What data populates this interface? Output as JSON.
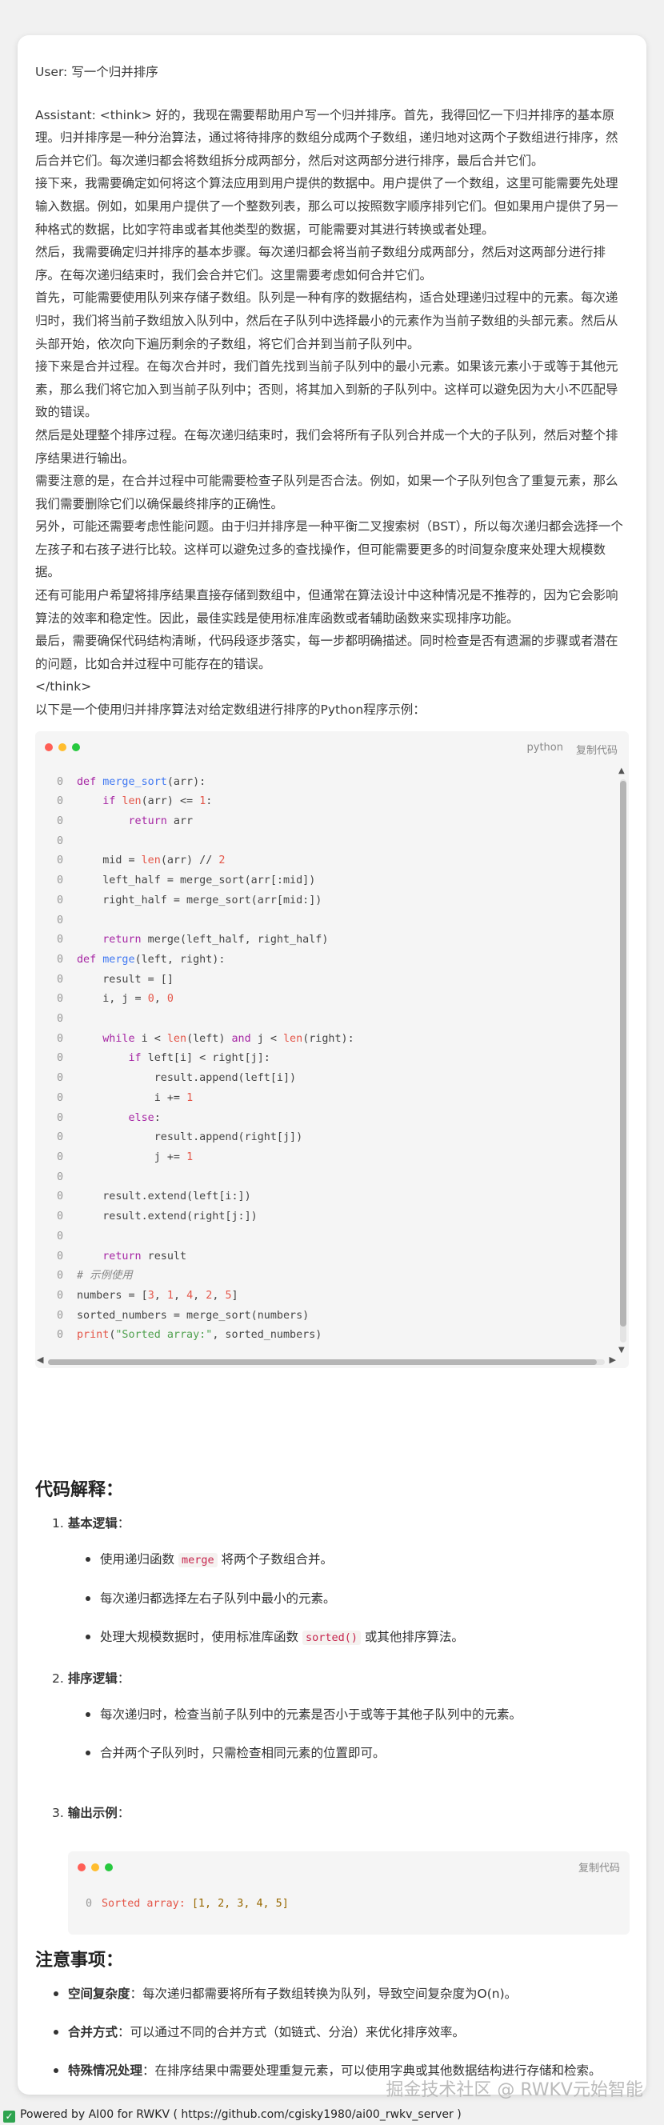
{
  "conversation": {
    "user_line": "User: 写一个归并排序",
    "assistant_paragraphs": [
      "Assistant: <think> 好的，我现在需要帮助用户写一个归并排序。首先，我得回忆一下归并排序的基本原理。归并排序是一种分治算法，通过将待排序的数组分成两个子数组，递归地对这两个子数组进行排序，然后合并它们。每次递归都会将数组拆分成两部分，然后对这两部分进行排序，最后合并它们。",
      "接下来，我需要确定如何将这个算法应用到用户提供的数据中。用户提供了一个数组，这里可能需要先处理输入数据。例如，如果用户提供了一个整数列表，那么可以按照数字顺序排列它们。但如果用户提供了另一种格式的数据，比如字符串或者其他类型的数据，可能需要对其进行转换或者处理。",
      "然后，我需要确定归并排序的基本步骤。每次递归都会将当前子数组分成两部分，然后对这两部分进行排序。在每次递归结束时，我们会合并它们。这里需要考虑如何合并它们。",
      "首先，可能需要使用队列来存储子数组。队列是一种有序的数据结构，适合处理递归过程中的元素。每次递归时，我们将当前子数组放入队列中，然后在子队列中选择最小的元素作为当前子数组的头部元素。然后从头部开始，依次向下遍历剩余的子数组，将它们合并到当前子队列中。",
      "接下来是合并过程。在每次合并时，我们首先找到当前子队列中的最小元素。如果该元素小于或等于其他元素，那么我们将它加入到当前子队列中；否则，将其加入到新的子队列中。这样可以避免因为大小不匹配导致的错误。",
      "然后是处理整个排序过程。在每次递归结束时，我们会将所有子队列合并成一个大的子队列，然后对整个排序结果进行输出。",
      "需要注意的是，在合并过程中可能需要检查子队列是否合法。例如，如果一个子队列包含了重复元素，那么我们需要删除它们以确保最终排序的正确性。",
      "另外，可能还需要考虑性能问题。由于归并排序是一种平衡二叉搜索树（BST），所以每次递归都会选择一个左孩子和右孩子进行比较。这样可以避免过多的查找操作，但可能需要更多的时间复杂度来处理大规模数据。",
      "还有可能用户希望将排序结果直接存储到数组中，但通常在算法设计中这种情况是不推荐的，因为它会影响算法的效率和稳定性。因此，最佳实践是使用标准库函数或者辅助函数来实现排序功能。",
      "最后，需要确保代码结构清晰，代码段逐步落实，每一步都明确描述。同时检查是否有遗漏的步骤或者潜在的问题，比如合并过程中可能存在的错误。",
      "</think>",
      "以下是一个使用归并排序算法对给定数组进行排序的Python程序示例："
    ]
  },
  "codeblock": {
    "language": "python",
    "copy_label": "复制代码",
    "line_number": "0",
    "lines": [
      "def merge_sort(arr):",
      "    if len(arr) <= 1:",
      "        return arr",
      "",
      "    mid = len(arr) // 2",
      "    left_half = merge_sort(arr[:mid])",
      "    right_half = merge_sort(arr[mid:])",
      "",
      "    return merge(left_half, right_half)",
      "def merge(left, right):",
      "    result = []",
      "    i, j = 0, 0",
      "",
      "    while i < len(left) and j < len(right):",
      "        if left[i] < right[j]:",
      "            result.append(left[i])",
      "            i += 1",
      "        else:",
      "            result.append(right[j])",
      "            j += 1",
      "",
      "    result.extend(left[i:])",
      "    result.extend(right[j:])",
      "",
      "    return result",
      "# 示例使用",
      "numbers = [3, 1, 4, 2, 5]",
      "sorted_numbers = merge_sort(numbers)",
      "print(\"Sorted array:\", sorted_numbers)"
    ]
  },
  "explanation": {
    "heading": "代码解释：",
    "items": [
      {
        "number": "1.",
        "title": "基本逻辑",
        "colon": "：",
        "bullets": [
          {
            "pre": "使用递归函数 ",
            "code": "merge",
            "post": " 将两个子数组合并。"
          },
          {
            "pre": "每次递归都选择左右子队列中最小的元素。",
            "code": "",
            "post": ""
          },
          {
            "pre": "处理大规模数据时，使用标准库函数 ",
            "code": "sorted()",
            "post": " 或其他排序算法。"
          }
        ]
      },
      {
        "number": "2.",
        "title": "排序逻辑",
        "colon": "：",
        "bullets": [
          {
            "pre": "每次递归时，检查当前子队列中的元素是否小于或等于其他子队列中的元素。",
            "code": "",
            "post": ""
          },
          {
            "pre": "合并两个子队列时，只需检查相同元素的位置即可。",
            "code": "",
            "post": ""
          }
        ]
      },
      {
        "number": "3.",
        "title": "输出示例",
        "colon": "：",
        "bullets": []
      }
    ],
    "output_code": {
      "copy_label": "复制代码",
      "line_number": "0",
      "text_plain": "Sorted array: ",
      "text_value": "[1, 2, 3, 4, 5]"
    }
  },
  "notes": {
    "heading": "注意事项：",
    "items": [
      {
        "title": "空间复杂度",
        "text": "：每次递归都需要将所有子数组转换为队列，导致空间复杂度为O(n)。"
      },
      {
        "title": "合并方式",
        "text": "：可以通过不同的合并方式（如链式、分治）来优化排序效率。"
      },
      {
        "title": "特殊情况处理",
        "text": "：在排序结果中需要处理重复元素，可以使用字典或其他数据结构进行存储和检索。"
      }
    ]
  },
  "watermark": "掘金技术社区 @ RWKV元始智能",
  "footer": {
    "text": "Powered by AI00 for RWKV ( https://github.com/cgisky1980/ai00_rwkv_server )"
  },
  "colors": {
    "dot_red": "#ff5f56",
    "dot_yellow": "#ffbd2e",
    "dot_green": "#27c93f",
    "footer_check": "#2ea44f"
  }
}
